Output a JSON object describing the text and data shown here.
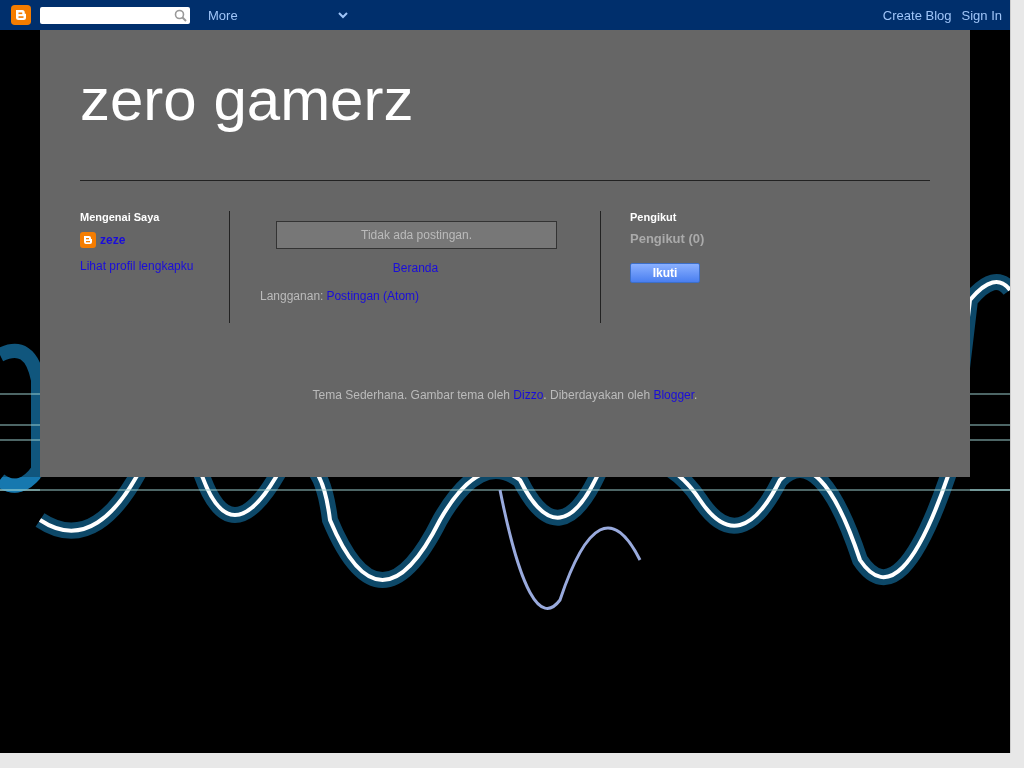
{
  "navbar": {
    "more": "More",
    "links": [
      "Create Blog",
      "Sign In"
    ]
  },
  "blog": {
    "title": "zero gamerz"
  },
  "about": {
    "heading": "Mengenai Saya",
    "name": "zeze",
    "profile_link": "Lihat profil lengkapku"
  },
  "main": {
    "no_posts": "Tidak ada postingan.",
    "home_link": "Beranda",
    "subscribe_label": "Langganan:",
    "subscribe_link": "Postingan (Atom)"
  },
  "followers": {
    "heading": "Pengikut",
    "count": "Pengikut (0)",
    "button": "Ikuti"
  },
  "footer": [
    {
      "kind": "text",
      "text": "Tema Sederhana. Gambar tema oleh "
    },
    {
      "kind": "link",
      "text": "Dizzo"
    },
    {
      "kind": "text",
      "text": ". Diberdayakan oleh "
    },
    {
      "kind": "link",
      "text": "Blogger"
    },
    {
      "kind": "text",
      "text": "."
    }
  ]
}
